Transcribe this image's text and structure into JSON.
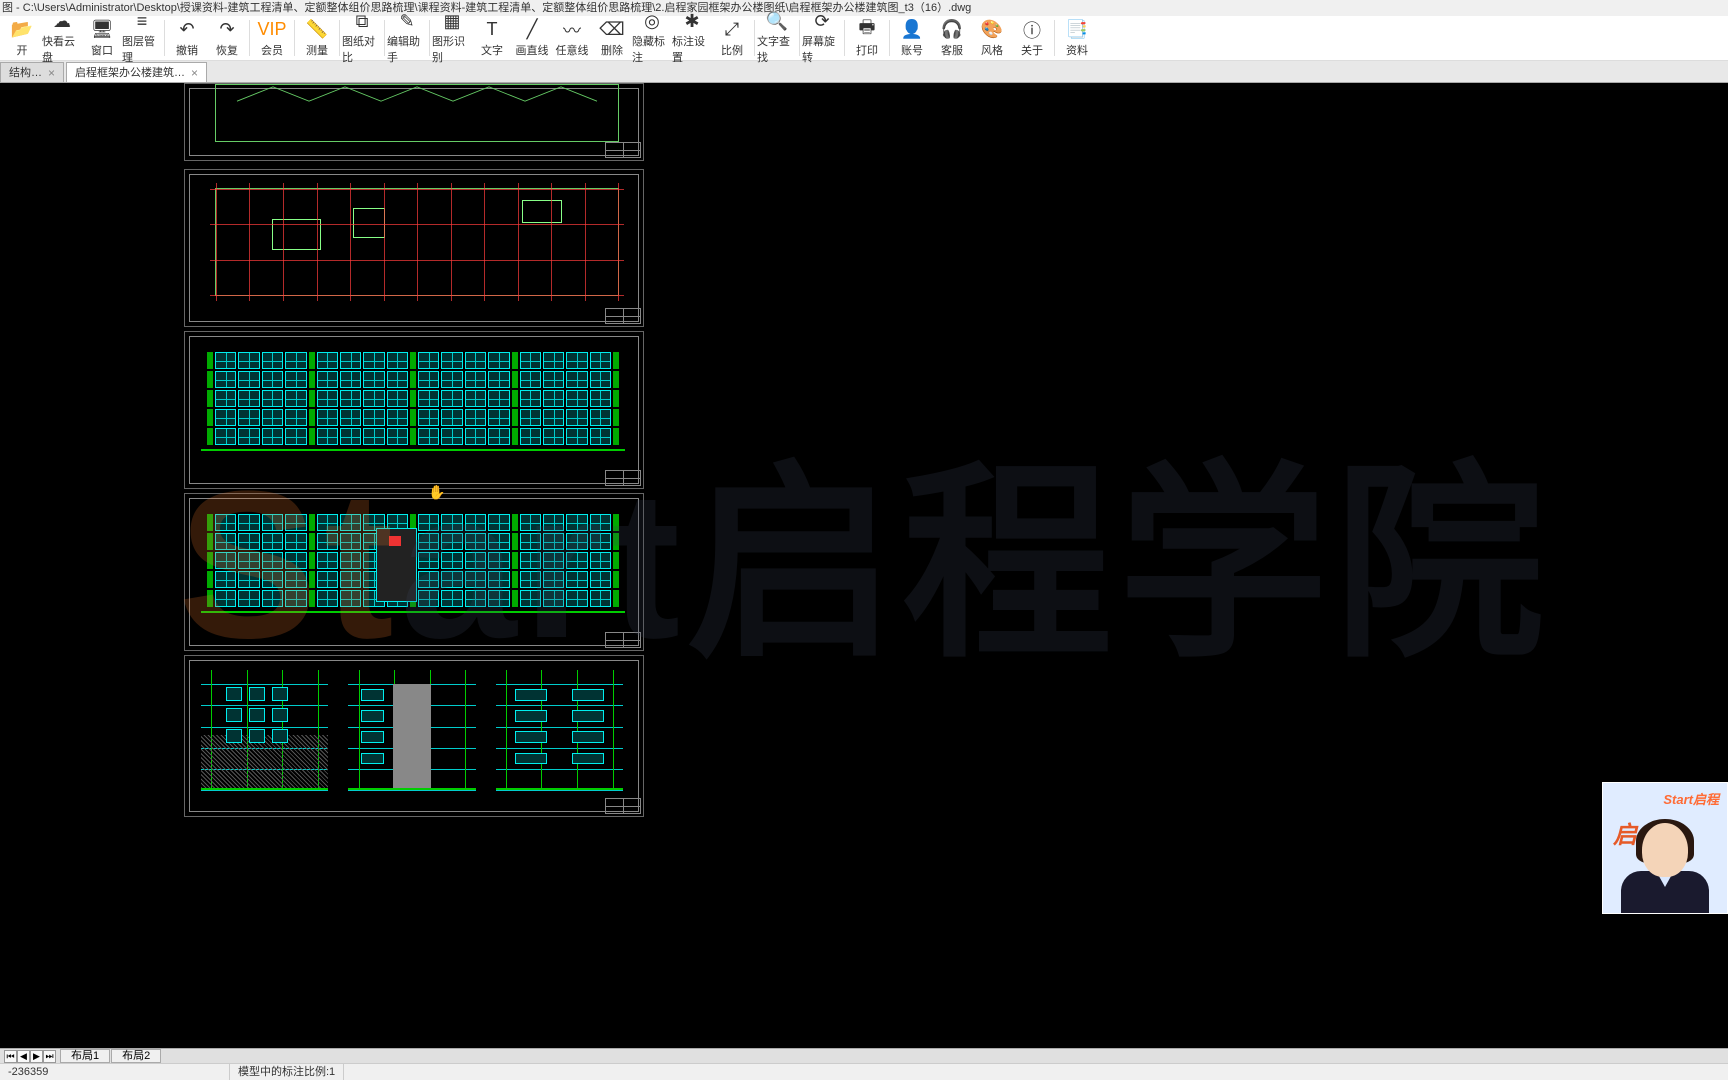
{
  "title": "图 - C:\\Users\\Administrator\\Desktop\\授课资料-建筑工程清单、定额整体组价思路梳理\\课程资料-建筑工程清单、定额整体组价思路梳理\\2.启程家园框架办公楼图纸\\启程框架办公楼建筑图_t3（16）.dwg",
  "toolbar": [
    {
      "label": "开",
      "icon": "📂"
    },
    {
      "label": "快看云盘",
      "icon": "☁"
    },
    {
      "label": "窗口",
      "icon": "🖥"
    },
    {
      "label": "图层管理",
      "icon": "≡"
    },
    {
      "sep": true
    },
    {
      "label": "撤销",
      "icon": "↶"
    },
    {
      "label": "恢复",
      "icon": "↷"
    },
    {
      "sep": true
    },
    {
      "label": "会员",
      "icon": "VIP",
      "vip": true
    },
    {
      "sep": true
    },
    {
      "label": "测量",
      "icon": "📏"
    },
    {
      "sep": true
    },
    {
      "label": "图纸对比",
      "icon": "⧉"
    },
    {
      "sep": true
    },
    {
      "label": "编辑助手",
      "icon": "✎"
    },
    {
      "sep": true
    },
    {
      "label": "图形识别",
      "icon": "▦"
    },
    {
      "label": "文字",
      "icon": "T"
    },
    {
      "label": "画直线",
      "icon": "╱"
    },
    {
      "label": "任意线",
      "icon": "〰"
    },
    {
      "label": "删除",
      "icon": "⌫"
    },
    {
      "label": "隐藏标注",
      "icon": "◎"
    },
    {
      "label": "标注设置",
      "icon": "✱"
    },
    {
      "label": "比例",
      "icon": "⤢"
    },
    {
      "sep": true
    },
    {
      "label": "文字查找",
      "icon": "🔍"
    },
    {
      "sep": true
    },
    {
      "label": "屏幕旋转",
      "icon": "⟳"
    },
    {
      "sep": true
    },
    {
      "label": "打印",
      "icon": "🖶"
    },
    {
      "sep": true
    },
    {
      "label": "账号",
      "icon": "👤"
    },
    {
      "label": "客服",
      "icon": "🎧"
    },
    {
      "label": "风格",
      "icon": "🎨"
    },
    {
      "label": "关于",
      "icon": "ⓘ"
    },
    {
      "sep": true
    },
    {
      "label": "资料",
      "icon": "📑"
    }
  ],
  "tabs": [
    {
      "label": "结构…",
      "active": false
    },
    {
      "label": "启程框架办公楼建筑…",
      "active": true
    }
  ],
  "watermark": {
    "logo": "St",
    "rest": "art",
    "text": "启程学院"
  },
  "video": {
    "brand": "Start启程",
    "brand2": "启   学"
  },
  "bottom_tabs": [
    "布局1",
    "布局2"
  ],
  "status": {
    "coords": "-236359",
    "scale": "模型中的标注比例:1"
  }
}
